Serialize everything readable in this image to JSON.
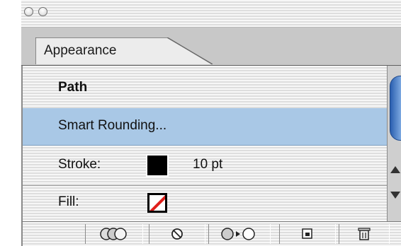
{
  "window": {
    "close_button": "close",
    "minimize_button": "minimize"
  },
  "tab": {
    "label": "Appearance"
  },
  "rows": {
    "path": {
      "label": "Path"
    },
    "smart_rounding": {
      "label": "Smart Rounding..."
    },
    "stroke": {
      "label": "Stroke:",
      "color": "#000000",
      "value": "10 pt"
    },
    "fill": {
      "label": "Fill:",
      "state": "none"
    }
  },
  "bottom_toolbar": [
    {
      "icon": "new-art-basic-appearance-icon"
    },
    {
      "icon": "clear-appearance-icon"
    },
    {
      "icon": "reduce-to-basic-appearance-icon"
    },
    {
      "icon": "duplicate-item-icon"
    },
    {
      "icon": "delete-item-icon"
    }
  ],
  "colors": {
    "selection": "#a9c8e6",
    "scroll_thumb": "#3a70c0",
    "fill_none_slash": "#e0201b"
  }
}
